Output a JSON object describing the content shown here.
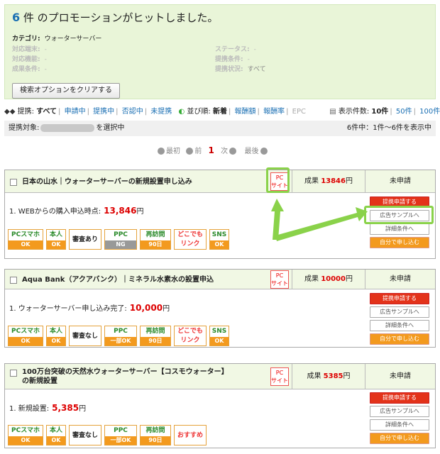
{
  "summary": {
    "count": "6",
    "title": " 件 のプロモーションがヒットしました。"
  },
  "fields": {
    "category": {
      "k": "カテゴリ:",
      "v": "ウォーターサーバー"
    },
    "device": {
      "k": "対応端末:",
      "v": "-"
    },
    "feature": {
      "k": "対応機能:",
      "v": "-"
    },
    "cond": {
      "k": "成果条件:",
      "v": "-"
    },
    "status": {
      "k": "ステータス:",
      "v": "-"
    },
    "pcond": {
      "k": "提携条件:",
      "v": "-"
    },
    "pstate": {
      "k": "提携状況:",
      "v": "すべて"
    }
  },
  "clear_button": "検索オプションをクリアする",
  "filter": {
    "label": "提携:",
    "all": "すべて",
    "f1": "申請中",
    "f2": "提携中",
    "f3": "否認中",
    "f4": "未提携",
    "sort_label": "並び順:",
    "s1": "新着",
    "s2": "報酬額",
    "s3": "報酬率",
    "s4": "EPC",
    "disp_label": "表示件数:",
    "d1": "10件",
    "d2": "50件",
    "d3": "100件",
    "sep": "|"
  },
  "target": {
    "label": "提携対象:",
    "suffix": "を選択中",
    "right": "6件中：1件〜6件を表示中"
  },
  "pager": {
    "first": "最初",
    "prev": "前",
    "page": "1",
    "next": "次",
    "last": "最後"
  },
  "pc_badge": {
    "l1": "PC",
    "l2": "サイト"
  },
  "reward_prefix": "成果",
  "yen": "円",
  "promos": [
    {
      "title": "日本の山水｜ウォーターサーバーの新規設置申し込み",
      "reward": "13846",
      "status": "未申請",
      "cond_text": "1. WEBからの購入申込時点:",
      "cond_amt": "13,846",
      "review": "審査あり",
      "ppc": "NG",
      "extra": "SNS"
    },
    {
      "title": "Aqua Bank（アクアバンク）｜ミネラル水素水の設置申込",
      "reward": "10000",
      "status": "未申請",
      "cond_text": "1. ウォーターサーバー申し込み完了:",
      "cond_amt": "10,000",
      "review": "審査なし",
      "ppc": "一部OK",
      "extra": "SNS"
    },
    {
      "title": "100万台突破の天然水ウォーターサーバー【コスモウォーター】",
      "title2": "の新規設置",
      "reward": "5385",
      "status": "未申請",
      "cond_text": "1. 新規設置:",
      "cond_amt": "5,385",
      "review": "審査なし",
      "ppc": "一部OK",
      "extra": "おすすめ"
    }
  ],
  "badges": {
    "pcsp": "PCスマホ",
    "ok": "OK",
    "honnin": "本人",
    "ppc": "PPC",
    "saishin": "再訪問",
    "nichi": "90日",
    "doko1": "どこでも",
    "doko2": "リンク",
    "sns": "SNS"
  },
  "actions": {
    "apply": "提携申請する",
    "sample": "広告サンプルへ",
    "detail": "詳細条件へ",
    "self": "自分で申し込む"
  },
  "colors": {
    "accent": "#1a6fb3",
    "amount": "#d00000",
    "highlight": "#8ad24a",
    "apply": "#e3331a",
    "self": "#f39a1e"
  }
}
